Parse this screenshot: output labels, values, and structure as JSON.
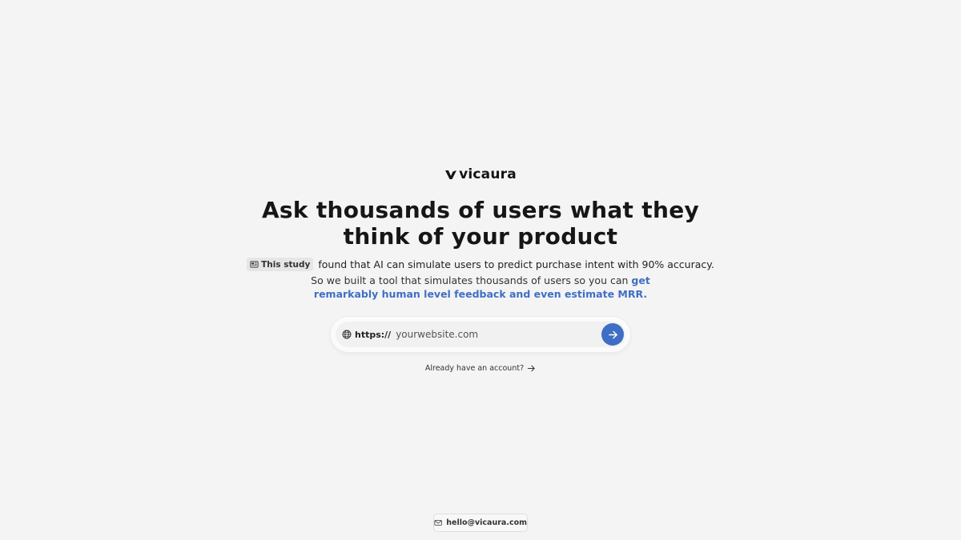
{
  "brand": {
    "name": "vicaura"
  },
  "hero": {
    "headline_line1": "Ask thousands of users what they",
    "headline_line2": "think of your product",
    "study_badge": "This study",
    "study_text": "found that AI can simulate users to predict purchase intent with 90% accuracy.",
    "sub_text": "So we built a tool that simulates thousands of users so you can",
    "sub_highlight": "get remarkably human level feedback and even estimate MRR."
  },
  "url_form": {
    "prefix": "https://",
    "placeholder": "yourwebsite.com"
  },
  "account": {
    "link_label": "Already have an account?"
  },
  "footer": {
    "email": "hello@vicaura.com"
  },
  "colors": {
    "accent": "#3f6fc4",
    "background": "#f4f4f4"
  },
  "icons": [
    "logo-mark-icon",
    "newspaper-icon",
    "globe-icon",
    "arrow-right-icon",
    "mail-icon"
  ]
}
